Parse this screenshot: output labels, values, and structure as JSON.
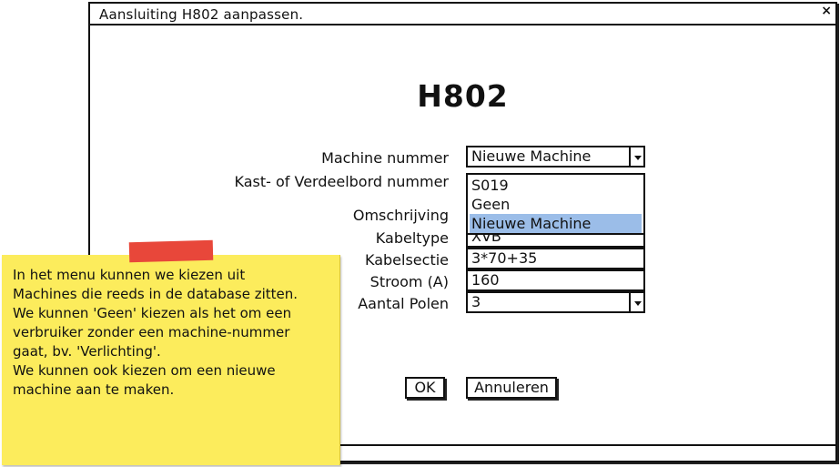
{
  "window": {
    "title": "Aansluiting H802 aanpassen.",
    "close_glyph": "×"
  },
  "heading": "H802",
  "form": {
    "machine_nummer": {
      "label": "Machine nummer",
      "value": "Nieuwe Machine"
    },
    "kast_nummer": {
      "label": "Kast- of Verdeelbord nummer"
    },
    "omschrijving": {
      "label": "Omschrijving"
    },
    "kabeltype": {
      "label": "Kabeltype",
      "value": "XVB"
    },
    "kabelsectie": {
      "label": "Kabelsectie",
      "value": "3*70+35"
    },
    "stroom": {
      "label": "Stroom (A)",
      "value": "160"
    },
    "aantal_polen": {
      "label": "Aantal Polen",
      "value": "3"
    }
  },
  "machine_menu": {
    "options": [
      "S019",
      "Geen",
      "Nieuwe Machine"
    ],
    "selected_index": 2
  },
  "buttons": {
    "ok": "OK",
    "cancel": "Annuleren"
  },
  "note": {
    "text": "In het menu kunnen we kiezen uit\nMachines die reeds in de database zitten.\nWe kunnen 'Geen' kiezen als het om een\nverbruiker zonder een machine-nummer\ngaat, bv. 'Verlichting'.\nWe kunnen ook kiezen om een nieuwe\nmachine aan te maken.",
    "color": "#fcec5c",
    "tape_color": "#e8473a"
  },
  "colors": {
    "selection": "#9bbde8"
  }
}
